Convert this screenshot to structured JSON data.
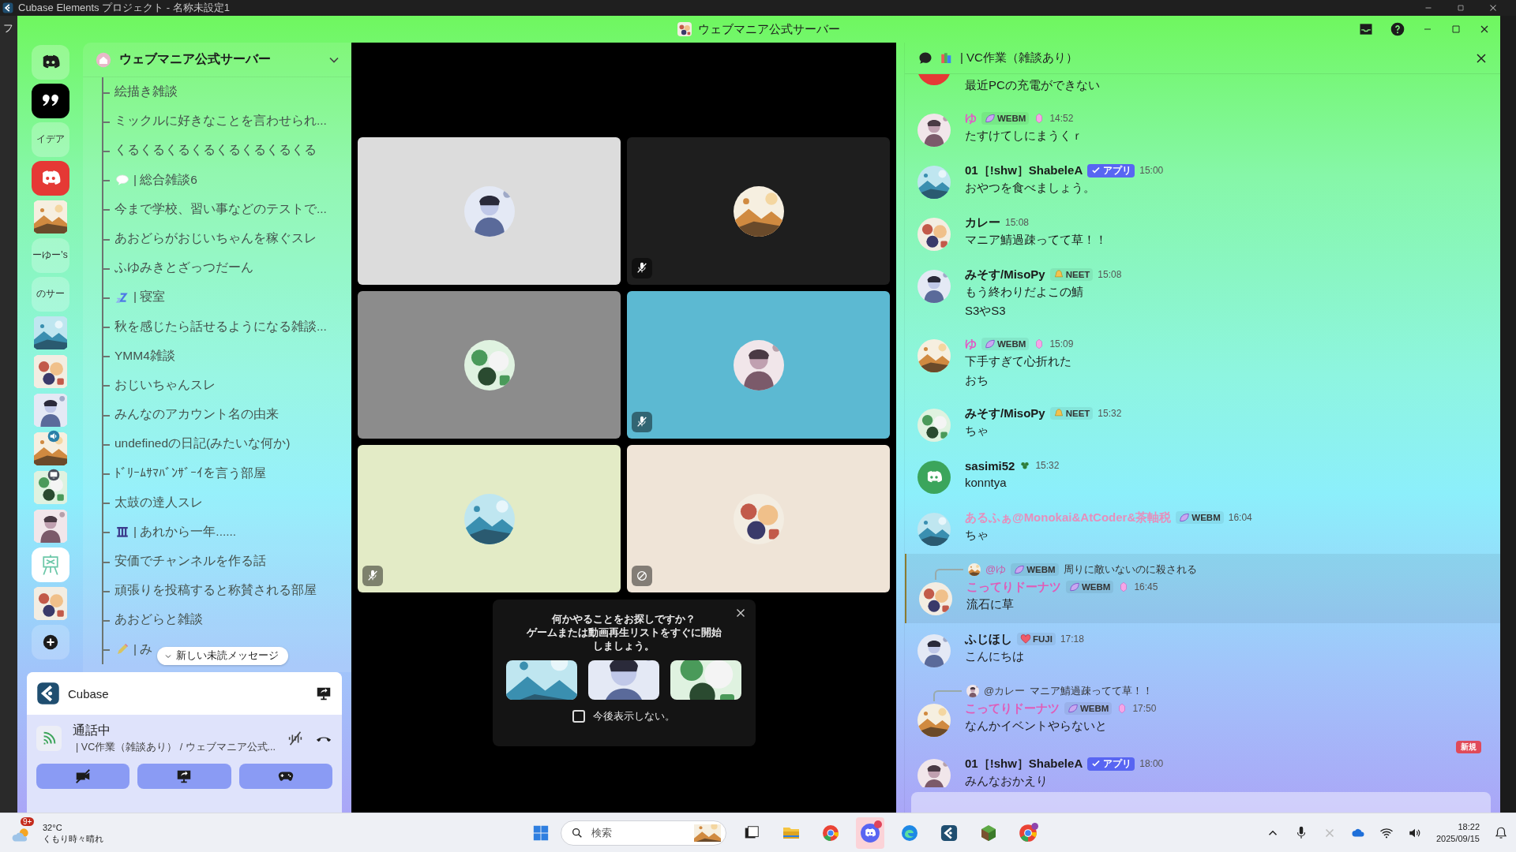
{
  "os_title": "Cubase Elements プロジェクト - 名称未設定1",
  "behind_menu": "フ",
  "window": {
    "title": "ウェブマニア公式サーバー"
  },
  "servers": [
    {
      "kind": "home"
    },
    {
      "kind": "quote"
    },
    {
      "kind": "text",
      "label": "イデア"
    },
    {
      "kind": "red-logo"
    },
    {
      "kind": "picture"
    },
    {
      "kind": "text",
      "label": "ーゆー's"
    },
    {
      "kind": "text",
      "label": "のサー"
    },
    {
      "kind": "picture"
    },
    {
      "kind": "picture"
    },
    {
      "kind": "picture"
    },
    {
      "kind": "picture",
      "badge": {
        "kind": "speaker"
      }
    },
    {
      "kind": "picture",
      "badge": {
        "kind": "screen"
      }
    },
    {
      "kind": "picture"
    },
    {
      "kind": "easel"
    },
    {
      "kind": "picture"
    },
    {
      "kind": "add"
    }
  ],
  "sidebar": {
    "server_name": "ウェブマニア公式サーバー",
    "channels": [
      {
        "label": "絵描き雑談"
      },
      {
        "label": "ミックルに好きなことを言わせられ..."
      },
      {
        "label": "くるくるくるくるくるくるくるくる"
      },
      {
        "label": "| 総合雑談6",
        "icon": {
          "kind": "speech"
        }
      },
      {
        "label": "今まで学校、習い事などのテストで..."
      },
      {
        "label": "あおどらがおじいちゃんを稼ぐスレ"
      },
      {
        "label": "ふゆみきとざっつだーん"
      },
      {
        "label": "| 寝室",
        "icon": {
          "kind": "zzz"
        }
      },
      {
        "label": "秋を感じたら話せるようになる雑談..."
      },
      {
        "label": "YMM4雑談"
      },
      {
        "label": "おじいちゃんスレ"
      },
      {
        "label": "みんなのアカウント名の由来"
      },
      {
        "label": "undefinedの日記(みたいな何か)"
      },
      {
        "label": "ﾄﾞﾘｰﾑｻﾏﾊﾞﾝｻﾞｰｲを言う部屋"
      },
      {
        "label": "太鼓の達人スレ"
      },
      {
        "label": "| あれから一年......",
        "icon": {
          "kind": "pillar"
        }
      },
      {
        "label": "安価でチャンネルを作る話"
      },
      {
        "label": "頑張りを投稿すると称賛される部屋"
      },
      {
        "label": "あおどらと雑談"
      },
      {
        "label": "| み",
        "icon": {
          "kind": "pencil"
        }
      }
    ],
    "new_messages_pill": "新しい未読メッセージ"
  },
  "user_panel": {
    "app": "Cubase",
    "call_status": "通話中",
    "call_channel": "| VC作業（雑談あり） / ウェブマニア公式...",
    "buttons": [
      {
        "kind": "camera-off"
      },
      {
        "kind": "screen-share"
      },
      {
        "kind": "activity"
      }
    ]
  },
  "video_tiles": [
    {
      "color": "#dcdcdc",
      "kind": "plain"
    },
    {
      "color": "#1e1e1e",
      "kind": "muted"
    },
    {
      "color": "#8c8c8c",
      "kind": "plain"
    },
    {
      "color": "#5cb9d2",
      "kind": "muted"
    },
    {
      "color": "#e3ebc6",
      "kind": "muted"
    },
    {
      "color": "#efe4d7",
      "kind": "blocked"
    }
  ],
  "activity_popup": {
    "lines": [
      "何かやることをお探しですか？",
      "ゲームまたは動画再生リストをすぐに開始しましょう。"
    ],
    "games": [
      {
        "kind": "picture"
      },
      {
        "kind": "picture"
      },
      {
        "kind": "picture"
      }
    ],
    "checkbox": {
      "label": "今後表示しない。",
      "checked": false
    }
  },
  "chat": {
    "channel": "| VC作業（雑談あり）",
    "messages": [
      {
        "kind": "cut",
        "avatar": {
          "kind": "red"
        },
        "highlighted": false,
        "lines": [
          "最近PCの充電ができない"
        ]
      },
      {
        "kind": "message",
        "author": "ゆ",
        "color": "#e05cc4",
        "tag": {
          "kind": "leaf",
          "label": "WEBM"
        },
        "boost": true,
        "time": "14:52",
        "avatar": {
          "kind": "picture"
        },
        "highlighted": false,
        "lines": [
          "たすけてしにまうくｒ"
        ]
      },
      {
        "kind": "message",
        "author": "01［!shw］ShabeleA",
        "color": "#1a1a1a",
        "tag": {
          "kind": "app",
          "label": "アプリ"
        },
        "boost": false,
        "time": "15:00",
        "avatar": {
          "kind": "picture"
        },
        "highlighted": false,
        "lines": [
          "おやつを食べましょう。"
        ]
      },
      {
        "kind": "message",
        "author": "カレー",
        "color": "#1a1a1a",
        "boost": false,
        "time": "15:08",
        "avatar": {
          "kind": "picture"
        },
        "highlighted": false,
        "lines": [
          "マニア鯖過疎ってて草！！"
        ]
      },
      {
        "kind": "message",
        "author": "みそす/MisoPy",
        "color": "#1a1a1a",
        "tag": {
          "kind": "bell",
          "label": "NEET"
        },
        "boost": false,
        "time": "15:08",
        "avatar": {
          "kind": "picture"
        },
        "highlighted": false,
        "lines": [
          "もう終わりだよこの鯖",
          "S3やS3"
        ]
      },
      {
        "kind": "message",
        "author": "ゆ",
        "color": "#e05cc4",
        "tag": {
          "kind": "leaf",
          "label": "WEBM"
        },
        "boost": true,
        "time": "15:09",
        "avatar": {
          "kind": "picture"
        },
        "highlighted": false,
        "lines": [
          "下手すぎて心折れた",
          "おち"
        ]
      },
      {
        "kind": "message",
        "author": "みそす/MisoPy",
        "color": "#1a1a1a",
        "tag": {
          "kind": "bell",
          "label": "NEET"
        },
        "boost": false,
        "time": "15:32",
        "avatar": {
          "kind": "picture"
        },
        "highlighted": false,
        "lines": [
          "ちゃ"
        ]
      },
      {
        "kind": "message",
        "author": "sasimi52",
        "color": "#1a1a1a",
        "tag": {
          "kind": "clover"
        },
        "boost": false,
        "time": "15:32",
        "avatar": {
          "kind": "green"
        },
        "highlighted": false,
        "lines": [
          "konntya"
        ]
      },
      {
        "kind": "message",
        "author": "あるふぁ@Monokai&AtCoder&茶軸税",
        "color": "#e58fbc",
        "tag": {
          "kind": "leaf",
          "label": "WEBM"
        },
        "boost": false,
        "time": "16:04",
        "avatar": {
          "kind": "picture"
        },
        "highlighted": false,
        "lines": [
          "ちゃ"
        ]
      },
      {
        "kind": "message",
        "author": "こってりドーナツ",
        "color": "#e05cb8",
        "tag": {
          "kind": "leaf",
          "label": "WEBM"
        },
        "boost": true,
        "time": "16:45",
        "avatar": {
          "kind": "picture"
        },
        "highlighted": true,
        "reply": {
          "author": "@ゆ",
          "color": "#c95aa8",
          "tag": {
            "kind": "leaf",
            "label": "WEBM"
          },
          "text": "周りに敵いないのに殺される"
        },
        "lines": [
          "流石に草"
        ]
      },
      {
        "kind": "message",
        "author": "ふじほし",
        "color": "#1a1a1a",
        "tag": {
          "kind": "heart",
          "label": "FUJI"
        },
        "boost": false,
        "time": "17:18",
        "avatar": {
          "kind": "picture"
        },
        "highlighted": false,
        "lines": [
          "こんにちは"
        ]
      },
      {
        "kind": "message",
        "author": "こってりドーナツ",
        "color": "#e05cb8",
        "tag": {
          "kind": "leaf",
          "label": "WEBM"
        },
        "boost": true,
        "time": "17:50",
        "avatar": {
          "kind": "picture"
        },
        "highlighted": false,
        "reply": {
          "author": "@カレー",
          "color": "#444444",
          "text": "マニア鯖過疎ってて草！！"
        },
        "lines": [
          "なんかイベントやらないと"
        ]
      },
      {
        "kind": "divider",
        "label": "新規"
      },
      {
        "kind": "message",
        "author": "01［!shw］ShabeleA",
        "color": "#1a1a1a",
        "tag": {
          "kind": "app",
          "label": "アプリ"
        },
        "boost": false,
        "time": "18:00",
        "avatar": {
          "kind": "picture"
        },
        "highlighted": false,
        "lines": [
          "みんなおかえり"
        ]
      }
    ]
  },
  "taskbar": {
    "weather": {
      "badge": "9+",
      "temp": "32°C",
      "desc": "くもり時々晴れ"
    },
    "search": {
      "placeholder": "検索"
    },
    "apps": [
      {
        "kind": "taskview",
        "active": false
      },
      {
        "kind": "folder",
        "active": false
      },
      {
        "kind": "chrome",
        "active": false
      },
      {
        "kind": "discord",
        "active": true
      },
      {
        "kind": "edge",
        "active": false
      },
      {
        "kind": "cubase",
        "active": false
      },
      {
        "kind": "cube",
        "active": false
      },
      {
        "kind": "chrome-profile",
        "active": false
      }
    ],
    "time": "18:22",
    "date": "2025/09/15"
  }
}
